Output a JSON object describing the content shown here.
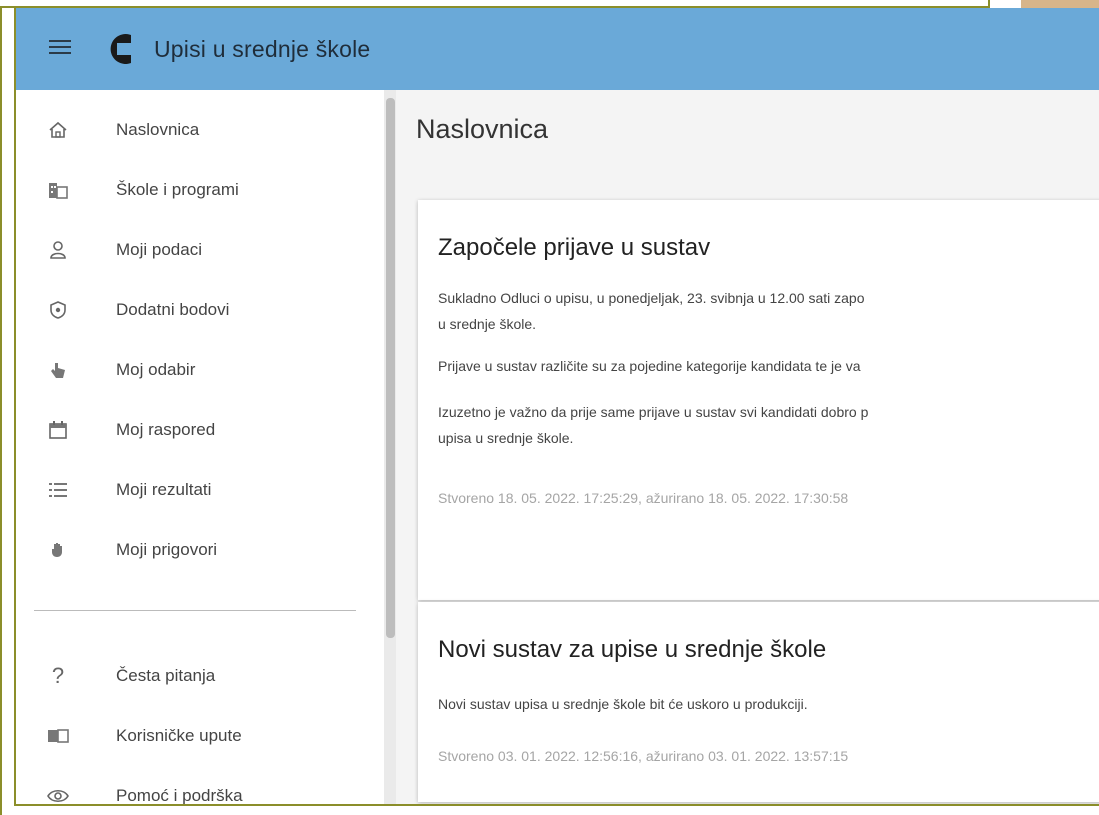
{
  "app": {
    "title": "Upisi u srednje škole"
  },
  "sidebar": {
    "items": [
      {
        "label": "Naslovnica",
        "icon": "home-icon"
      },
      {
        "label": "Škole i programi",
        "icon": "building-icon"
      },
      {
        "label": "Moji podaci",
        "icon": "person-icon"
      },
      {
        "label": "Dodatni bodovi",
        "icon": "shield-icon"
      },
      {
        "label": "Moj odabir",
        "icon": "touch-icon"
      },
      {
        "label": "Moj raspored",
        "icon": "calendar-icon"
      },
      {
        "label": "Moji rezultati",
        "icon": "list-icon"
      },
      {
        "label": "Moji prigovori",
        "icon": "hand-icon"
      }
    ],
    "secondary": [
      {
        "label": "Česta pitanja",
        "icon": "question-icon"
      },
      {
        "label": "Korisničke upute",
        "icon": "book-icon"
      },
      {
        "label": "Pomoć i podrška",
        "icon": "eye-icon"
      }
    ]
  },
  "main": {
    "title": "Naslovnica",
    "cards": [
      {
        "title": "Započele prijave u sustav",
        "paragraphs": [
          "Sukladno Odluci o upisu, u ponedjeljak, 23. svibnja u 12.00 sati zapo",
          "u srednje škole.",
          "Prijave u sustav različite su za pojedine kategorije kandidata te je va",
          "Izuzetno je važno da prije same prijave u sustav svi kandidati dobro p",
          "upisa u srednje škole."
        ],
        "meta": "Stvoreno 18. 05. 2022. 17:25:29, ažurirano 18. 05. 2022. 17:30:58"
      },
      {
        "title": "Novi sustav za upise u srednje škole",
        "paragraphs": [
          "Novi sustav upisa u srednje škole bit će uskoro u produkciji."
        ],
        "meta": "Stvoreno 03. 01. 2022. 12:56:16, ažurirano 03. 01. 2022. 13:57:15"
      }
    ]
  }
}
